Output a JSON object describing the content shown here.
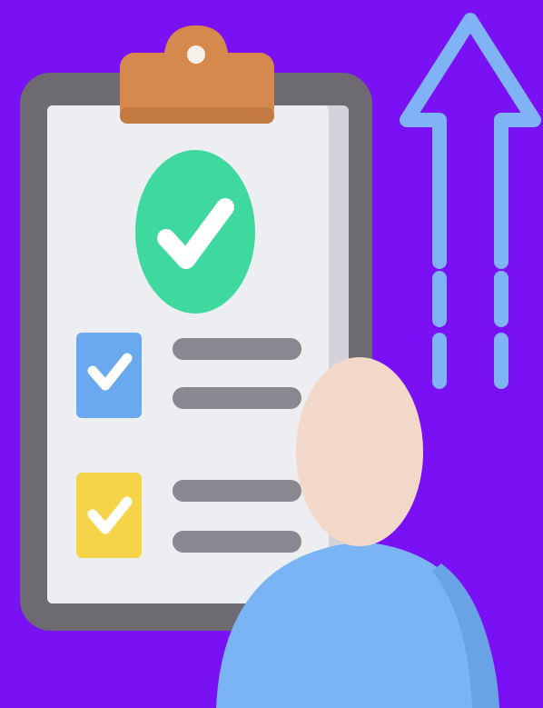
{
  "illustration": {
    "icons": [
      "clipboard-icon",
      "clip-icon",
      "big-check-badge-icon",
      "checkbox-blue-icon",
      "checkbox-yellow-icon",
      "up-arrow-icon",
      "person-icon"
    ],
    "colors": {
      "background": "#7a10f4",
      "clipboard_board": "#6e6a72",
      "clipboard_paper": "#eceef2",
      "clipboard_paper_shadow": "#d4d3db",
      "clip": "#d6894c",
      "check_badge": "#3fd89f",
      "checkbox_blue": "#6aa8f0",
      "checkbox_yellow": "#f6d44a",
      "text_lines": "#8a8790",
      "arrow": "#7fb3f6",
      "person_head": "#f2d8c8",
      "person_body": "#7ab4f4",
      "check_mark": "#ffffff"
    }
  }
}
